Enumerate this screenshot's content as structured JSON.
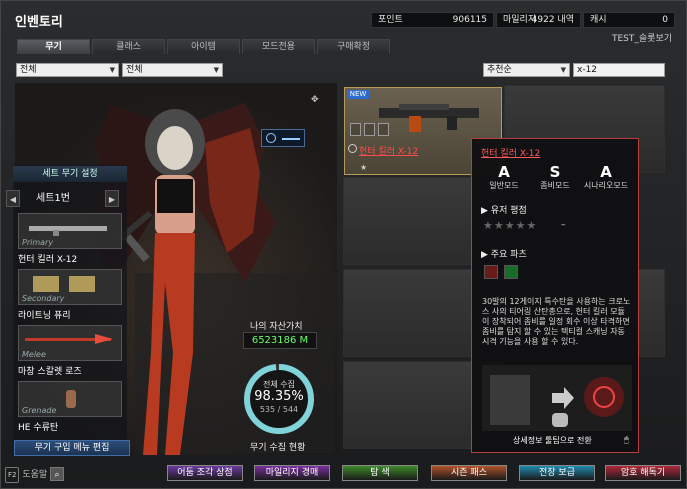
{
  "window": {
    "title": "인벤토리",
    "account": "TEST_슬롯보기"
  },
  "stats": [
    {
      "label": "포인트",
      "value": "906115"
    },
    {
      "label": "마일리지",
      "value": "4922 내역"
    },
    {
      "label": "캐시",
      "value": "0"
    }
  ],
  "tabs": [
    "무기",
    "클래스",
    "아이템",
    "모드전용",
    "구매확정"
  ],
  "filters": {
    "category1": "전체",
    "category2": "전체",
    "sort": "추천순",
    "search_value": "x-12"
  },
  "set_panel": {
    "title": "세트 무기 설정",
    "set_name": "세트1번",
    "slots": [
      {
        "type": "Primary",
        "name": "헌터 킬러 X-12"
      },
      {
        "type": "Secondary",
        "name": "라이트닝 퓨리"
      },
      {
        "type": "Melee",
        "name": "마창 스칼렛 로즈"
      },
      {
        "type": "Grenade",
        "name": "HE 수류탄"
      }
    ],
    "buy_menu": "무기 구입 메뉴 편집"
  },
  "assets": {
    "label": "나의 자산가치",
    "value": "6523186 M",
    "collection_title": "전체 수집",
    "collection_percent": "98.35%",
    "collection_count": "535 / 544",
    "collection_fraction": 0.9835,
    "collection_label": "무기 수집 현황"
  },
  "featured_item": {
    "badge": "NEW",
    "name": "헌터 킬러 X-12",
    "stars": "★"
  },
  "detail": {
    "name": "헌터 킬러 X-12",
    "grades": [
      {
        "grade": "A",
        "mode": "일반모드"
      },
      {
        "grade": "S",
        "mode": "좀비모드"
      },
      {
        "grade": "A",
        "mode": "시나리오모드"
      }
    ],
    "rating_title": "유저 평점",
    "rating_stars": "★★★★★",
    "rating_value": "–",
    "parts_title": "주요 파츠",
    "description": "30발의 12게이지 특수탄을 사용하는 크로노스 사의 티어링 산탄총으로, 헌터 킬러 모듈이 장착되어 좀비를 일정 회수 이상 타격하면 좀비를 탐지 할 수 있는 텍티컬 스캐닝 자동 시격 기능을 사용 할 수 있다.",
    "detail_hint": "상세정보 툴팁으로 전환"
  },
  "bottom": {
    "help_key": "F2",
    "help_label": "도움말",
    "buttons": [
      {
        "label": "어둠 조각 상점",
        "color": "#6b3aa0"
      },
      {
        "label": "마일리지 경매",
        "color": "#7a2ea0"
      },
      {
        "label": "탐  색",
        "color": "#3c8a2a"
      },
      {
        "label": "시즌 패스",
        "color": "#b0522a"
      },
      {
        "label": "전장 보급",
        "color": "#1f8ab0"
      },
      {
        "label": "암호 해독기",
        "color": "#b0283a"
      }
    ]
  }
}
